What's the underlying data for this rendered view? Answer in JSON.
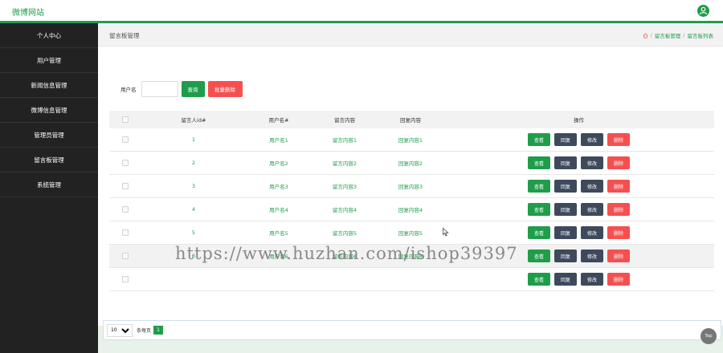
{
  "header": {
    "brand": "微博网站"
  },
  "sidebar": {
    "items": [
      {
        "label": "个人中心"
      },
      {
        "label": "用户管理"
      },
      {
        "label": "新闻信息管理"
      },
      {
        "label": "微博信息管理"
      },
      {
        "label": "管理员管理"
      },
      {
        "label": "留言板管理"
      },
      {
        "label": "系统管理"
      }
    ]
  },
  "page": {
    "title": "留言板管理",
    "breadcrumb": [
      "留言板管理",
      "留言板列表"
    ]
  },
  "search": {
    "label": "用户名",
    "value": "",
    "query_button": "查询",
    "batch_delete_button": "批量删除"
  },
  "table": {
    "headers": [
      "留言人id#",
      "用户名#",
      "留言内容",
      "回复内容",
      "操作"
    ],
    "rows": [
      {
        "id": "1",
        "user": "用户名1",
        "msg": "留言内容1",
        "reply": "回复内容1"
      },
      {
        "id": "2",
        "user": "用户名2",
        "msg": "留言内容2",
        "reply": "回复内容2"
      },
      {
        "id": "3",
        "user": "用户名3",
        "msg": "留言内容3",
        "reply": "回复内容3"
      },
      {
        "id": "4",
        "user": "用户名4",
        "msg": "留言内容4",
        "reply": "回复内容4"
      },
      {
        "id": "5",
        "user": "用户名5",
        "msg": "留言内容5",
        "reply": "回复内容5"
      },
      {
        "id": "6",
        "user": "用户名6",
        "msg": "留言内容6",
        "reply": "回复内容6"
      },
      {
        "id": "",
        "user": "",
        "msg": "",
        "reply": ""
      }
    ],
    "actions": {
      "view": "查看",
      "reply": "回复",
      "edit": "修改",
      "delete": "删除"
    }
  },
  "pager": {
    "page_size": "10",
    "label": "条每页",
    "current_page": "1"
  },
  "watermark": "https://www.huzhan.com/ishop39397",
  "top_button": "Top",
  "colors": {
    "accent": "#1f9d4a",
    "danger": "#f5504f",
    "dark": "#3e4a5c",
    "sidebar": "#222222"
  }
}
